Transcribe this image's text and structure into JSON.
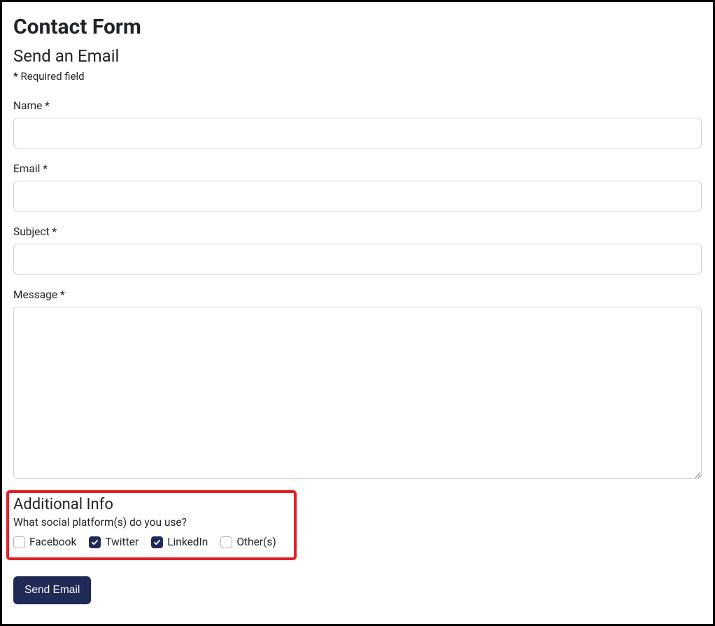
{
  "title": "Contact Form",
  "subtitle": "Send an Email",
  "requiredStar": "*",
  "requiredNote": "Required field",
  "fields": {
    "name": {
      "label": "Name *",
      "value": ""
    },
    "email": {
      "label": "Email *",
      "value": ""
    },
    "subject": {
      "label": "Subject *",
      "value": ""
    },
    "message": {
      "label": "Message *",
      "value": ""
    }
  },
  "additionalInfo": {
    "title": "Additional Info",
    "question": "What social platform(s) do you use?",
    "options": [
      {
        "label": "Facebook",
        "checked": false
      },
      {
        "label": "Twitter",
        "checked": true
      },
      {
        "label": "LinkedIn",
        "checked": true
      },
      {
        "label": "Other(s)",
        "checked": false
      }
    ]
  },
  "submit": {
    "label": "Send Email"
  }
}
